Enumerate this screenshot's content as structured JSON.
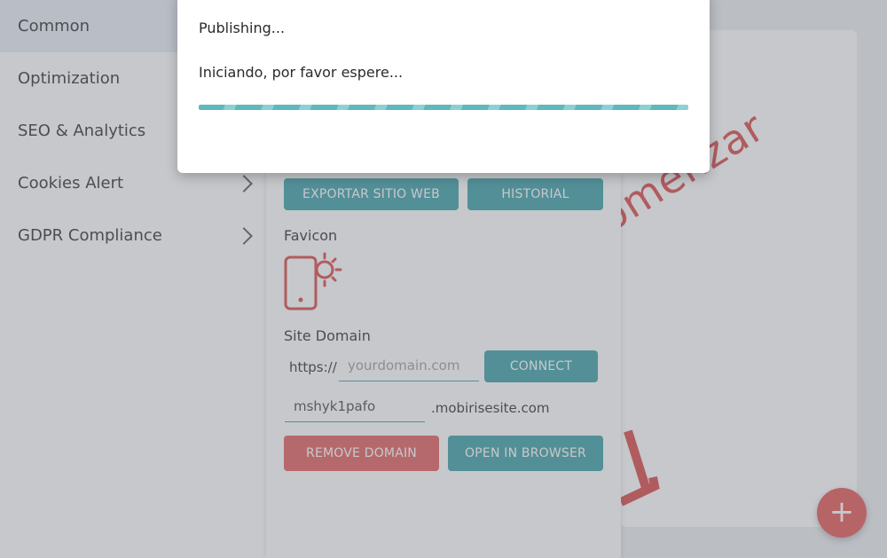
{
  "sidebar": {
    "items": [
      {
        "label": "Common",
        "active": true,
        "chevron": false
      },
      {
        "label": "Optimization",
        "active": false,
        "chevron": false
      },
      {
        "label": "SEO & Analytics",
        "active": false,
        "chevron": false
      },
      {
        "label": "Cookies Alert",
        "active": false,
        "chevron": true
      },
      {
        "label": "GDPR Compliance",
        "active": false,
        "chevron": true
      }
    ]
  },
  "panel": {
    "export_button": "EXPORTAR SITIO WEB",
    "history_button": "HISTORIAL",
    "favicon_label": "Favicon",
    "favicon_icon": "phone-brightness-icon",
    "site_domain_label": "Site Domain",
    "https_prefix": "https://",
    "domain_placeholder": "yourdomain.com",
    "connect_button": "CONNECT",
    "subdomain_value": "mshyk1pafo",
    "subdomain_suffix": ".mobirisesite.com",
    "remove_domain_button": "REMOVE DOMAIN",
    "open_browser_button": "OPEN IN BROWSER"
  },
  "canvas": {
    "text": "omenzar",
    "add_icon": "plus-icon"
  },
  "modal": {
    "status": "Publishing...",
    "message": "Iniciando, por favor espere..."
  },
  "colors": {
    "accent_teal": "#3a9ea5",
    "accent_red": "#e45c5c"
  }
}
